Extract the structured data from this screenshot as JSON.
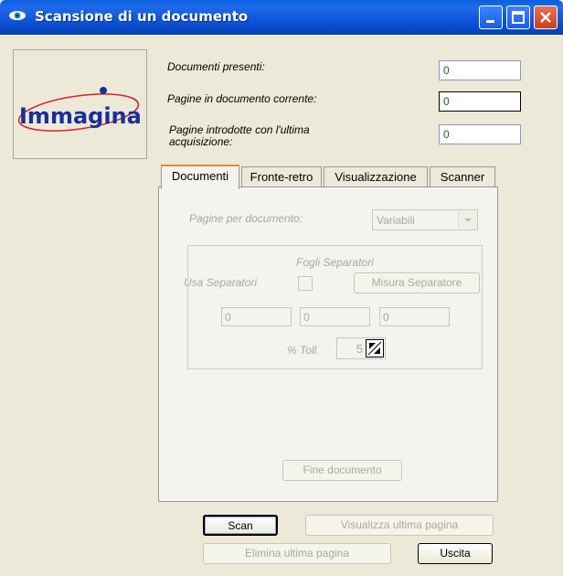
{
  "window": {
    "title": "Scansione di un documento",
    "logo_text": "Immagina"
  },
  "fields": [
    {
      "label": "Documenti presenti:",
      "value": "0"
    },
    {
      "label": "Pagine in documento corrente:",
      "value": "0"
    },
    {
      "label": "Pagine introdotte con l'ultima acquisizione:",
      "value": "0"
    }
  ],
  "tabs": [
    {
      "label": "Documenti",
      "active": true
    },
    {
      "label": "Fronte-retro",
      "active": false
    },
    {
      "label": "Visualizzazione",
      "active": false
    },
    {
      "label": "Scanner",
      "active": false
    }
  ],
  "documenti_tab": {
    "pages_label": "Pagine per documento:",
    "pages_select_value": "Variabili",
    "group_title": "Fogli Separatori",
    "use_separator_label": "Usa Separatori",
    "use_separator_checked": false,
    "measure_button": "Misura Separatore",
    "measure_values": [
      "0",
      "0",
      "0"
    ],
    "tolerance_label": "% Toll.",
    "tolerance_value": "5",
    "end_document_button": "Fine documento"
  },
  "buttons": {
    "scan": "Scan",
    "view_last": "Visualizza ultima pagina",
    "delete_last": "Elimina ultima pagina",
    "exit": "Uscita"
  },
  "colors": {
    "titlebar": "#0a4fd4",
    "window_bg": "#ece9d8",
    "field_value": "#008000",
    "active_tab_accent": "#e68b2c",
    "logo_text": "#1a2f9a",
    "logo_ellipse": "#e0202a"
  }
}
